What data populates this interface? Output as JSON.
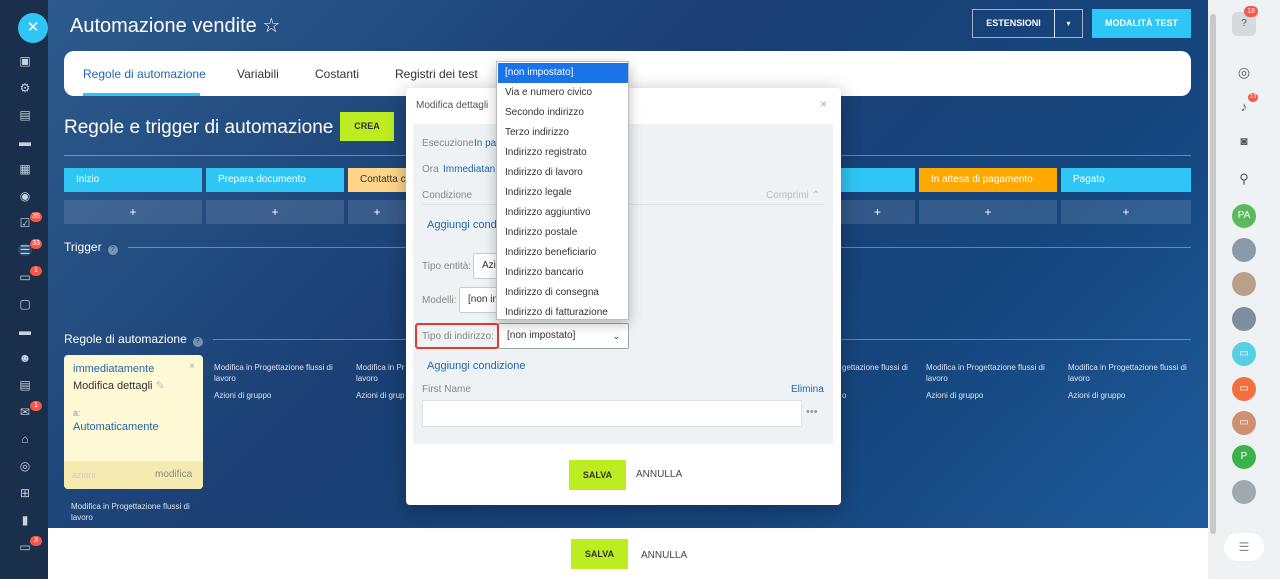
{
  "app": {
    "title": "Automazione vendite",
    "star": "☆"
  },
  "header": {
    "estensioni": "ESTENSIONI",
    "modalita": "MODALITÀ TEST"
  },
  "tabs": [
    "Regole di automazione",
    "Variabili",
    "Costanti",
    "Registri dei test"
  ],
  "page": {
    "heading": "Regole e trigger di automazione",
    "crea": "CREA"
  },
  "stages": [
    {
      "label": "Inizio",
      "color": "#2fc6f6"
    },
    {
      "label": "Prepara documento",
      "color": "#2fc6f6"
    },
    {
      "label": "Contatta c",
      "color": "#ffd58a"
    },
    {
      "label": "In attesa di pagamento",
      "color": "#ffa900"
    },
    {
      "label": "Pagato",
      "color": "#2fc6f6"
    }
  ],
  "sections": {
    "trigger": "Trigger",
    "rules": "Regole di automazione"
  },
  "card": {
    "when": "immediatamente",
    "title": "Modifica dettagli",
    "for": "a:",
    "who": "Automaticamente",
    "azioni": "azioni",
    "modifica": "modifica",
    "below": "Modifica in Progettazione flussi di lavoro"
  },
  "columns": {
    "text1": "Modifica in Progettazione flussi di lavoro",
    "text2": "Azioni di gruppo",
    "text1b": "Modifica in Progettazione flussi di",
    "text2b": "Azioni di grup",
    "text3": "gettazione flussi di"
  },
  "modal": {
    "title": "Modifica dettagli",
    "esecuzione": "Esecuzione",
    "esec_val": "In pa",
    "ora": "Ora",
    "ora_val": "Immediatan",
    "condizione": "Condizione",
    "comprimi": "Comprimi",
    "aggiungi1": "Aggiungi cond",
    "tipo_entita": "Tipo entità:",
    "tipo_entita_val": "Azie",
    "modelli": "Modelli:",
    "modelli_val": "[non im",
    "tipo_indirizzo": "Tipo di indirizzo:",
    "tipo_indirizzo_val": "[non impostato]",
    "aggiungi2": "Aggiungi condizione",
    "first_name": "First Name",
    "elimina": "Elimina",
    "salva": "SALVA",
    "annulla": "ANNULLA"
  },
  "dropdown": [
    "[non impostato]",
    "Via e numero civico",
    "Secondo indirizzo",
    "Terzo indirizzo",
    "Indirizzo registrato",
    "Indirizzo di lavoro",
    "Indirizzo legale",
    "Indirizzo aggiuntivo",
    "Indirizzo postale",
    "Indirizzo beneficiario",
    "Indirizzo bancario",
    "Indirizzo di consegna",
    "Indirizzo di fatturazione"
  ],
  "bottom": {
    "salva": "SALVA",
    "annulla": "ANNULLA"
  },
  "badges": {
    "notif_top": "18",
    "bell": "13",
    "left1": "33",
    "left2": "1",
    "left3": "1",
    "left4": "3",
    "left5": "35"
  },
  "right_avatars": {
    "pa": "PA",
    "p": "P"
  }
}
